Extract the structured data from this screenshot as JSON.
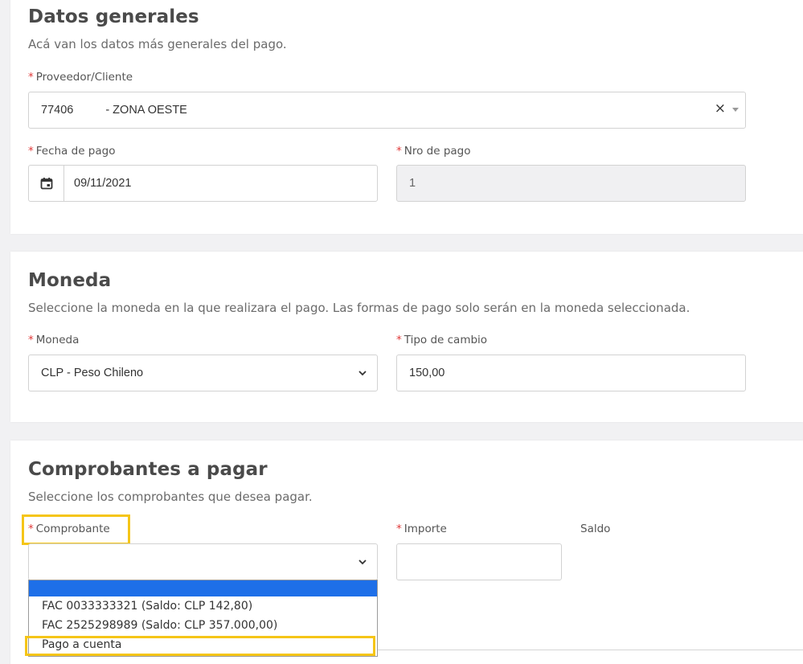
{
  "datos": {
    "title": "Datos generales",
    "subtitle": "Acá van los datos más generales del pago.",
    "proveedor_label": "Proveedor/Cliente",
    "proveedor_code": "77406",
    "proveedor_name": "- ZONA OESTE",
    "clear_glyph": "×",
    "fecha_label": "Fecha de pago",
    "fecha_value": "09/11/2021",
    "nro_label": "Nro de pago",
    "nro_value": "1"
  },
  "moneda": {
    "title": "Moneda",
    "subtitle": "Seleccione la moneda en la que realizara el pago. Las formas de pago solo serán en la moneda seleccionada.",
    "moneda_label": "Moneda",
    "moneda_value": "CLP - Peso Chileno",
    "tipo_label": "Tipo de cambio",
    "tipo_value": "150,00"
  },
  "comprobantes": {
    "title": "Comprobantes a pagar",
    "subtitle": "Seleccione los comprobantes que desea pagar.",
    "comprobante_label": "Comprobante",
    "importe_label": "Importe",
    "saldo_label": "Saldo",
    "options": [
      "",
      "FAC 0033333321 (Saldo: CLP 142,80)",
      "FAC 2525298989 (Saldo: CLP 357.000,00)",
      "Pago a cuenta"
    ]
  },
  "required_mark": "*",
  "colors": {
    "highlight": "#f5c518",
    "selected_option": "#1e6fe8",
    "required": "#e03a3a"
  }
}
